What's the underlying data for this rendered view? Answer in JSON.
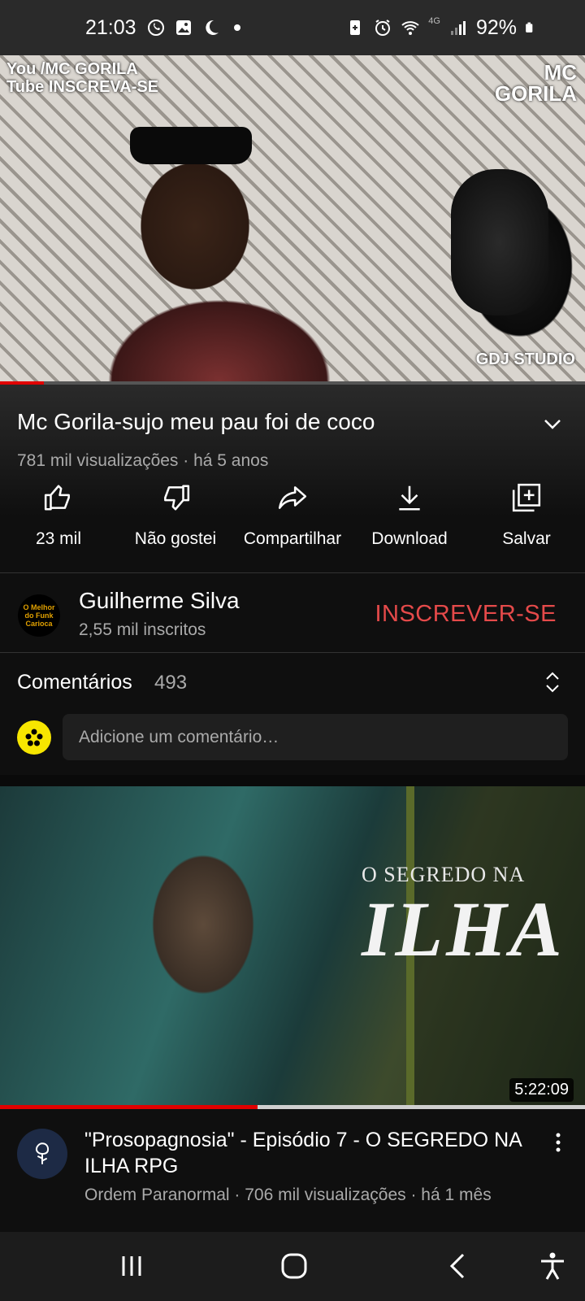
{
  "status_bar": {
    "time": "21:03",
    "battery": "92%",
    "network": "4G",
    "left_icons": [
      "whatsapp-icon",
      "gallery-icon",
      "moon-icon"
    ],
    "right_icons": [
      "battery-saver-icon",
      "alarm-icon",
      "wifi-icon",
      "signal-icon",
      "battery-icon"
    ]
  },
  "player": {
    "overlay_left_line1": "You /MC GORILA",
    "overlay_left_line2": "Tube INSCREVA-SE",
    "overlay_right_line1": "MC",
    "overlay_right_line2": "GORILA",
    "overlay_studio": "GDJ STUDIO",
    "progress": 0.075
  },
  "video": {
    "title": "Mc Gorila-sujo meu pau foi de coco",
    "meta": "781 mil visualizações · há 5 anos"
  },
  "actions": [
    {
      "name": "like-button",
      "icon": "thumbs-up-icon",
      "label": "23 mil"
    },
    {
      "name": "dislike-button",
      "icon": "thumbs-down-icon",
      "label": "Não gostei"
    },
    {
      "name": "share-button",
      "icon": "share-icon",
      "label": "Compartilhar"
    },
    {
      "name": "download-button",
      "icon": "download-icon",
      "label": "Download"
    },
    {
      "name": "save-button",
      "icon": "playlist-add-icon",
      "label": "Salvar"
    }
  ],
  "channel": {
    "avatar_text": "O Melhor do Funk Carioca",
    "name": "Guilherme Silva",
    "subscribers": "2,55 mil inscritos",
    "subscribe_label": "INSCREVER-SE",
    "subscribe_color": "#e54a4a"
  },
  "comments": {
    "title": "Comentários",
    "count": "493",
    "placeholder": "Adicione um comentário…"
  },
  "next_video": {
    "thumb_line1": "O SEGREDO NA",
    "thumb_line2": "ILHA",
    "duration": "5:22:09",
    "progress": 0.44,
    "title": "\"Prosopagnosia\" - Episódio 7 - O SEGREDO NA ILHA RPG",
    "meta": "Ordem Paranormal · 706 mil visualizações · há 1 mês"
  },
  "nav": [
    "recents-icon",
    "home-icon",
    "back-icon",
    "accessibility-icon"
  ],
  "colors": {
    "accent_red": "#e10000",
    "background": "#0f0f0f"
  }
}
